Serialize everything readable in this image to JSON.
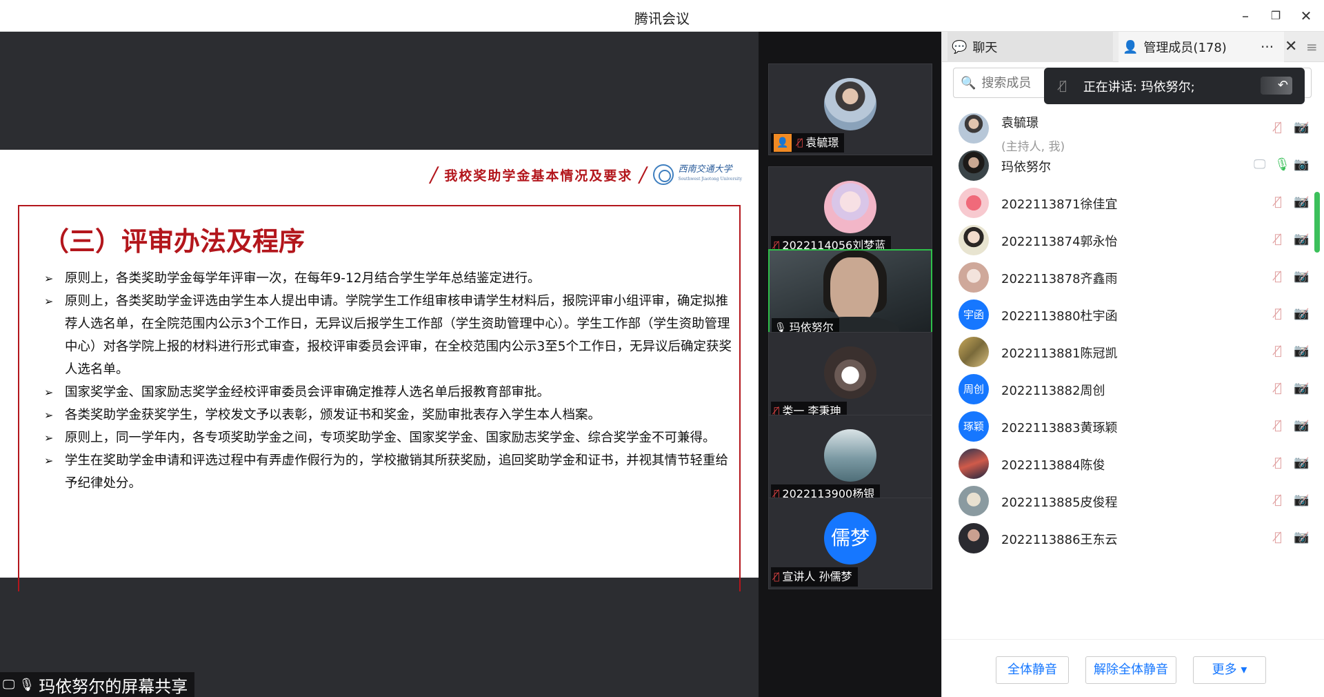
{
  "window": {
    "title": "腾讯会议",
    "minimize": "–",
    "restore": "❐",
    "close": "✕"
  },
  "slide": {
    "header_text": "我校奖助学金基本情况及要求",
    "logo_text": "西南交通大学",
    "logo_sub": "Southwest Jiaotong University",
    "section_title": "（三）评审办法及程序",
    "bullets": [
      "原则上，各类奖助学金每学年评审一次，在每年9-12月结合学生学年总结鉴定进行。",
      "原则上，各类奖助学金评选由学生本人提出申请。学院学生工作组审核申请学生材料后，报院评审小组评审，确定拟推荐人选名单，在全院范围内公示3个工作日，无异议后报学生工作部（学生资助管理中心）。学生工作部（学生资助管理中心）对各学院上报的材料进行形式审查，报校评审委员会评审，在全校范围内公示3至5个工作日，无异议后确定获奖人选名单。",
      "国家奖学金、国家励志奖学金经校评审委员会评审确定推荐人选名单后报教育部审批。",
      "各类奖助学金获奖学生，学校发文予以表彰，颁发证书和奖金，奖励审批表存入学生本人档案。",
      "原则上，同一学年内，各专项奖助学金之间，专项奖助学金、国家奖学金、国家励志奖学金、综合奖学金不可兼得。",
      "学生在奖助学金申请和评选过程中有弄虚作假行为的，学校撤销其所获奖励，追回奖助学金和证书，并视其情节轻重给予纪律处分。"
    ]
  },
  "share_bar": {
    "label": "玛依努尔的屏幕共享"
  },
  "video_tiles": [
    {
      "name": "袁毓璟",
      "host": true,
      "mic": "off"
    },
    {
      "name": "2022114056刘梦蓝",
      "host": false,
      "mic": "off"
    },
    {
      "name": "玛依努尔",
      "host": false,
      "mic": "on",
      "active": true
    },
    {
      "name": "类一 李秉珅",
      "host": false,
      "mic": "off"
    },
    {
      "name": "2022113900杨银",
      "host": false,
      "mic": "off"
    },
    {
      "name": "宣讲人 孙儒梦",
      "host": false,
      "mic": "off",
      "avatar_text": "儒梦"
    }
  ],
  "panel": {
    "tab_chat": "聊天",
    "tab_members": "管理成员(178)",
    "more": "···",
    "close": "✕",
    "menu": "≡",
    "search_placeholder": "搜索成员",
    "speaking": "正在讲话: 玛依努尔;",
    "members": [
      {
        "name": "袁毓璟",
        "sub": "(主持人, 我)"
      },
      {
        "name": "玛依努尔",
        "speaking": true
      },
      {
        "name": "2022113871徐佳宜"
      },
      {
        "name": "2022113874郭永怡"
      },
      {
        "name": "2022113878齐鑫雨"
      },
      {
        "name": "2022113880杜宇函",
        "avatar_text": "宇函"
      },
      {
        "name": "2022113881陈冠凯"
      },
      {
        "name": "2022113882周创",
        "avatar_text": "周创"
      },
      {
        "name": "2022113883黄琢颖",
        "avatar_text": "琢颖"
      },
      {
        "name": "2022113884陈俊"
      },
      {
        "name": "2022113885皮俊程"
      },
      {
        "name": "2022113886王东云"
      }
    ],
    "btn_mute_all": "全体静音",
    "btn_unmute_all": "解除全体静音",
    "btn_more": "更多 ▾"
  },
  "colors": {
    "accent": "#1677ff",
    "slide_red": "#b3161c",
    "active_green": "#2fc04a"
  }
}
